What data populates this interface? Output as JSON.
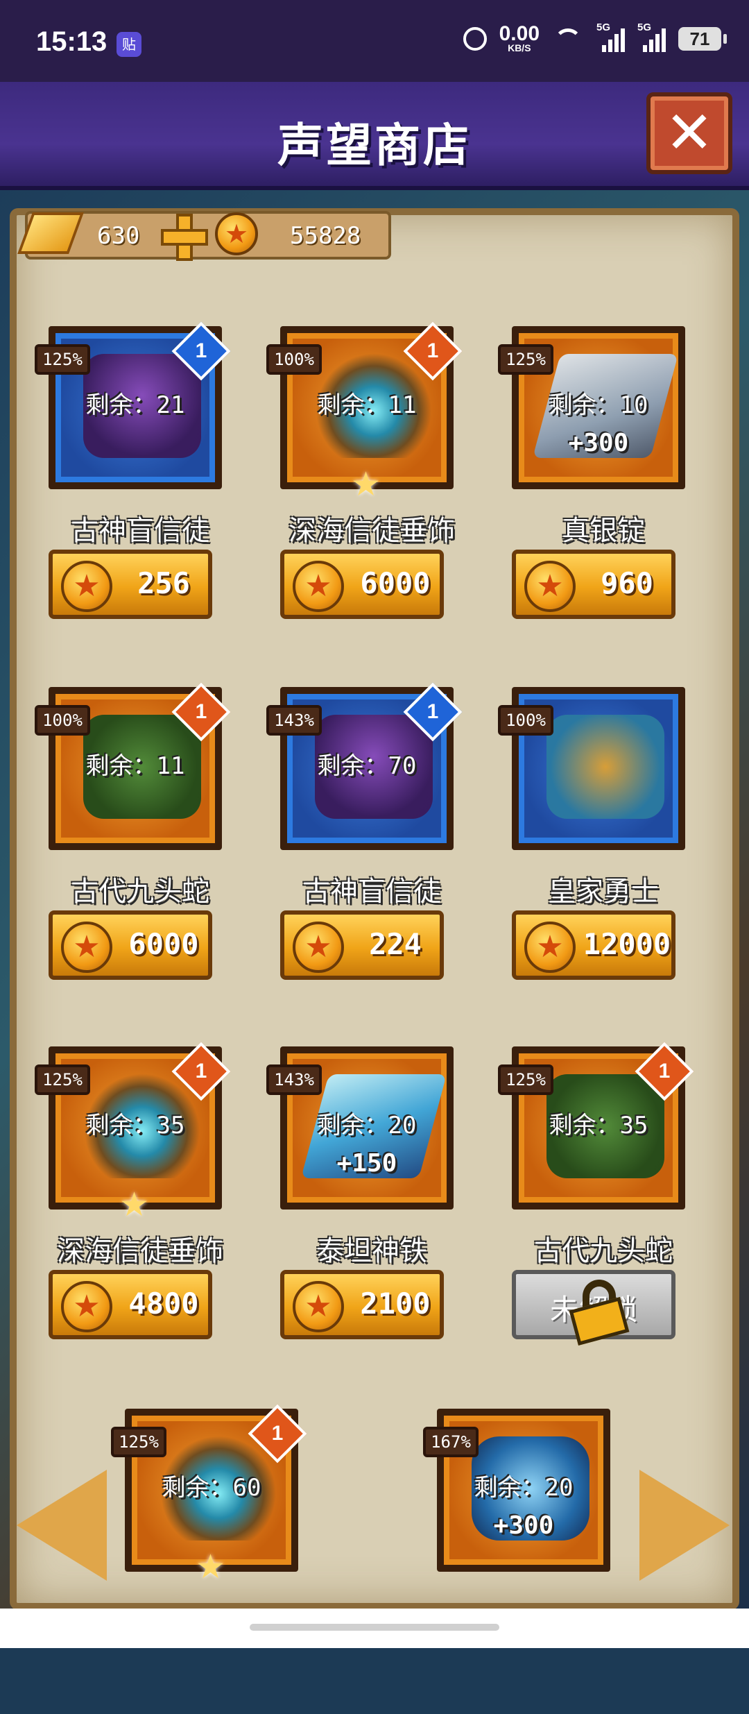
{
  "status_bar": {
    "time": "15:13",
    "app_icon": "贴",
    "net_speed": "0.00",
    "net_unit": "KB/S",
    "signal1": "5G",
    "signal2": "5G",
    "battery": "71"
  },
  "header": {
    "title": "声望商店",
    "close_label": "✕"
  },
  "currency": {
    "gold": "630",
    "coins": "55828"
  },
  "items": [
    {
      "name": "古神盲信徒",
      "percent": "125%",
      "remain": "剩余：21",
      "bonus": "",
      "gem": "1",
      "gem_color": "#1f64d8",
      "price": "256",
      "frame": "blue",
      "art": "octopus-icon",
      "star": false,
      "locked": false
    },
    {
      "name": "深海信徒垂饰",
      "percent": "100%",
      "remain": "剩余：11",
      "bonus": "",
      "gem": "1",
      "gem_color": "#e0561a",
      "price": "6000",
      "frame": "orange",
      "art": "amulet-icon",
      "star": true,
      "locked": false
    },
    {
      "name": "真银锭",
      "percent": "125%",
      "remain": "剩余：10",
      "bonus": "+300",
      "gem": "",
      "gem_color": "",
      "price": "960",
      "frame": "orange",
      "art": "silver-ingot-icon",
      "star": false,
      "locked": false
    },
    {
      "name": "古代九头蛇",
      "percent": "100%",
      "remain": "剩余：11",
      "bonus": "",
      "gem": "1",
      "gem_color": "#e0561a",
      "price": "6000",
      "frame": "orange",
      "art": "hydra-icon",
      "star": false,
      "locked": false
    },
    {
      "name": "古神盲信徒",
      "percent": "143%",
      "remain": "剩余：70",
      "bonus": "",
      "gem": "1",
      "gem_color": "#1f64d8",
      "price": "224",
      "frame": "blue",
      "art": "octopus-icon",
      "star": false,
      "locked": false
    },
    {
      "name": "皇家勇士",
      "percent": "100%",
      "remain": "",
      "bonus": "",
      "gem": "",
      "gem_color": "",
      "price": "12000",
      "frame": "blue",
      "art": "warrior-icon",
      "star": false,
      "locked": false
    },
    {
      "name": "深海信徒垂饰",
      "percent": "125%",
      "remain": "剩余：35",
      "bonus": "",
      "gem": "1",
      "gem_color": "#e0561a",
      "price": "4800",
      "frame": "orange",
      "art": "amulet-icon",
      "star": true,
      "locked": false
    },
    {
      "name": "泰坦神铁",
      "percent": "143%",
      "remain": "剩余：20",
      "bonus": "+150",
      "gem": "",
      "gem_color": "",
      "price": "2100",
      "frame": "orange",
      "art": "titan-iron-icon",
      "star": false,
      "locked": false
    },
    {
      "name": "古代九头蛇",
      "percent": "125%",
      "remain": "剩余：35",
      "bonus": "",
      "gem": "1",
      "gem_color": "#e0561a",
      "price": "",
      "frame": "orange",
      "art": "hydra-icon",
      "star": false,
      "locked": true,
      "locked_label": "未解锁"
    },
    {
      "name": "",
      "percent": "125%",
      "remain": "剩余：60",
      "bonus": "",
      "gem": "1",
      "gem_color": "#e0561a",
      "price": "",
      "frame": "orange",
      "art": "amulet-icon",
      "star": true,
      "locked": false
    },
    {
      "name": "",
      "percent": "167%",
      "remain": "剩余：20",
      "bonus": "+300",
      "gem": "",
      "gem_color": "",
      "price": "",
      "frame": "orange",
      "art": "scroll-icon",
      "star": false,
      "locked": false
    }
  ],
  "nav": {
    "prev": "arrow-left-icon",
    "next": "arrow-right-icon"
  }
}
